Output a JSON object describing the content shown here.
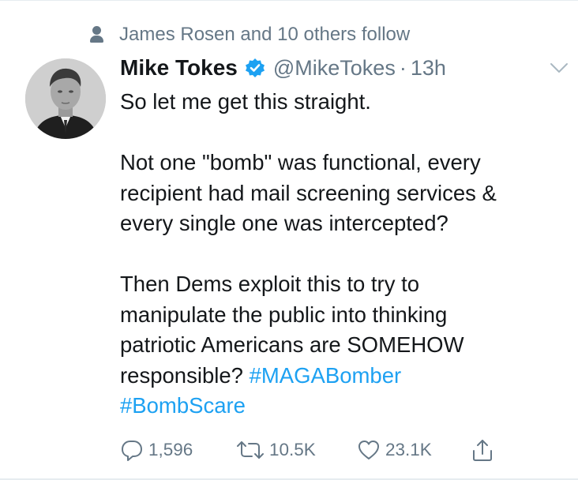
{
  "social_context": {
    "icon": "person-icon",
    "text": "James Rosen and 10 others follow"
  },
  "tweet": {
    "author": {
      "display_name": "Mike Tokes",
      "handle": "@MikeTokes",
      "verified": true
    },
    "separator": "·",
    "timestamp": "13h",
    "lines": [
      [
        "So let me get this straight."
      ],
      [],
      [
        "Not one \"bomb\" was functional, every"
      ],
      [
        "recipient had mail screening services &"
      ],
      [
        "every single one was intercepted?"
      ],
      [],
      [
        "Then Dems exploit this to try to"
      ],
      [
        "manipulate the public into thinking"
      ],
      [
        "patriotic Americans are SOMEHOW"
      ],
      [
        "responsible? "
      ],
      []
    ],
    "hashtags": [
      "#MAGABomber",
      "#BombScare"
    ],
    "actions": {
      "replies": "1,596",
      "retweets": "10.5K",
      "likes": "23.1K"
    }
  },
  "colors": {
    "text": "#14171a",
    "secondary": "#657786",
    "link": "#1da1f2",
    "divider": "#e6ecf0"
  }
}
